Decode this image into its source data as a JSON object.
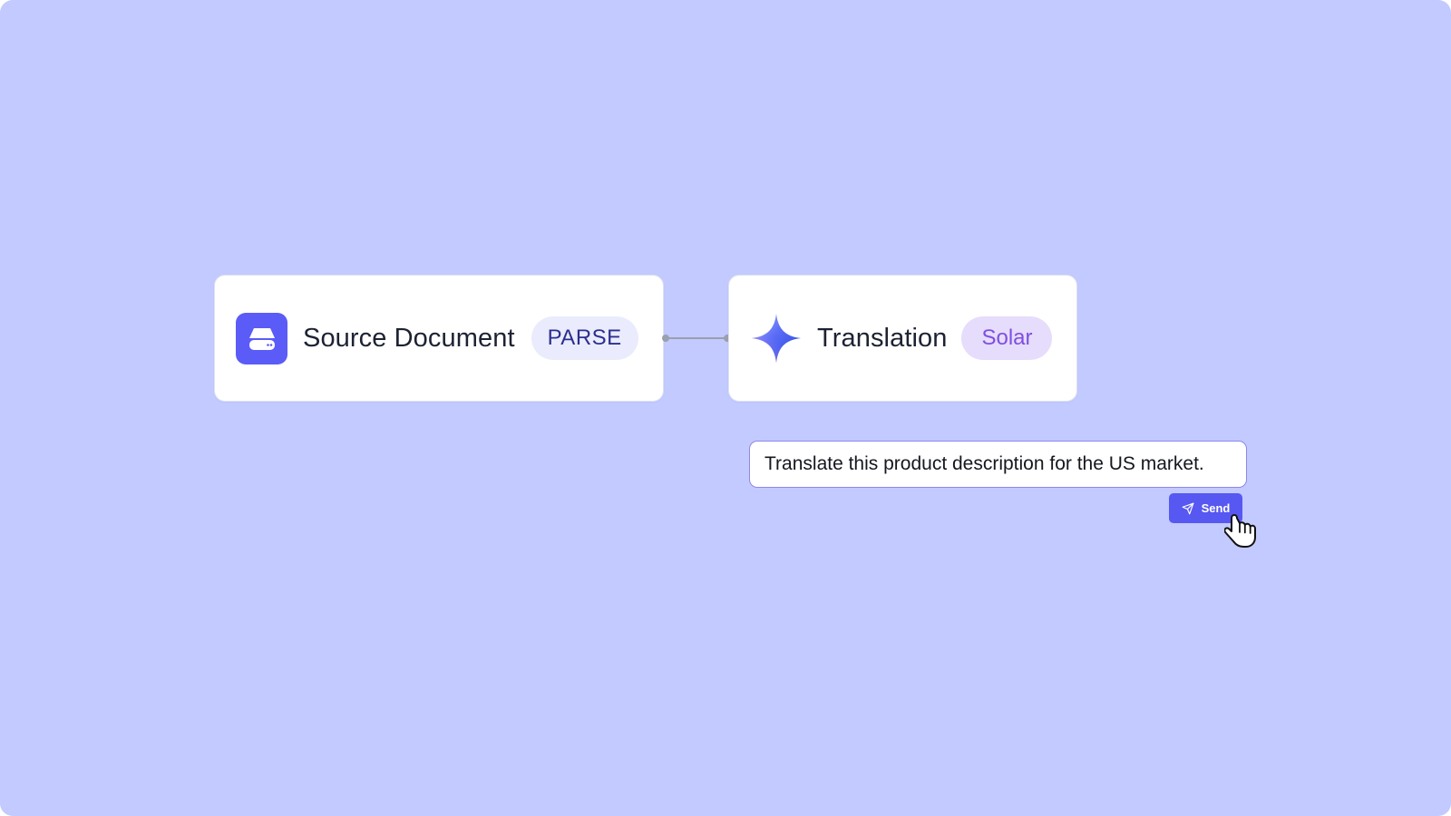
{
  "workflow": {
    "source_node": {
      "title": "Source Document",
      "badge": "PARSE",
      "icon": "document-drive-icon"
    },
    "translation_node": {
      "title": "Translation",
      "badge": "Solar",
      "icon": "sparkle-icon"
    }
  },
  "prompt": {
    "text": "Translate this product description for the US market."
  },
  "send_button": {
    "label": "Send",
    "icon": "send-icon"
  },
  "colors": {
    "canvas_background": "#c2caff",
    "accent": "#5757f2",
    "parse_badge_bg": "#eaecfd",
    "solar_badge_bg": "#e6dcfb",
    "solar_badge_text": "#7f4fe0"
  }
}
